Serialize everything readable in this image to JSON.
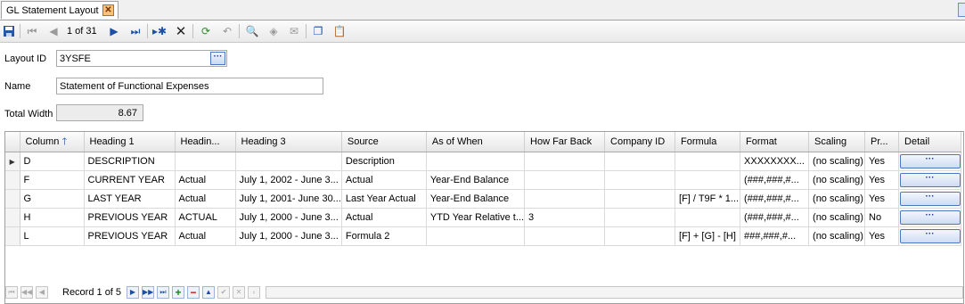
{
  "tab": {
    "title": "GL Statement Layout",
    "close": "✕"
  },
  "toolbar": {
    "position": "1 of 31"
  },
  "form": {
    "layout_id_label": "Layout ID",
    "layout_id_value": "3YSFE",
    "name_label": "Name",
    "name_value": "Statement of Functional Expenses",
    "total_width_label": "Total Width",
    "total_width_value": "8.67"
  },
  "grid": {
    "columns": [
      "Column",
      "Heading 1",
      "Headin...",
      "Heading 3",
      "Source",
      "As of When",
      "How Far Back",
      "Company ID",
      "Formula",
      "Format",
      "Scaling",
      "Pr...",
      "Detail"
    ],
    "rows": [
      [
        "D",
        "DESCRIPTION",
        "",
        "",
        "Description",
        "",
        "",
        "",
        "",
        "XXXXXXXX...",
        "(no scaling)",
        "Yes"
      ],
      [
        "F",
        "CURRENT YEAR",
        "Actual",
        "July 1, 2002 - June 3...",
        "Actual",
        "Year-End Balance",
        "",
        "",
        "",
        "(###,###,#...",
        "(no scaling)",
        "Yes"
      ],
      [
        "G",
        "LAST YEAR",
        "Actual",
        "July 1, 2001- June 30...",
        "Last Year Actual",
        "Year-End Balance",
        "",
        "",
        "[F] / T9F * 1...",
        "(###,###,#...",
        "(no scaling)",
        "Yes"
      ],
      [
        "H",
        "PREVIOUS YEAR",
        "ACTUAL",
        "July 1, 2000 - June 3...",
        "Actual",
        "YTD Year Relative t...",
        "3",
        "",
        "",
        "(###,###,#...",
        "(no scaling)",
        "No"
      ],
      [
        "L",
        "PREVIOUS YEAR",
        "Actual",
        "July 1, 2000 - June 3...",
        "Formula 2",
        "",
        "",
        "",
        "[F] + [G] - [H]",
        "###,###,#...",
        "(no scaling)",
        "Yes"
      ]
    ],
    "detail_label": "···"
  },
  "navigator": {
    "record_text": "Record 1 of 5"
  }
}
